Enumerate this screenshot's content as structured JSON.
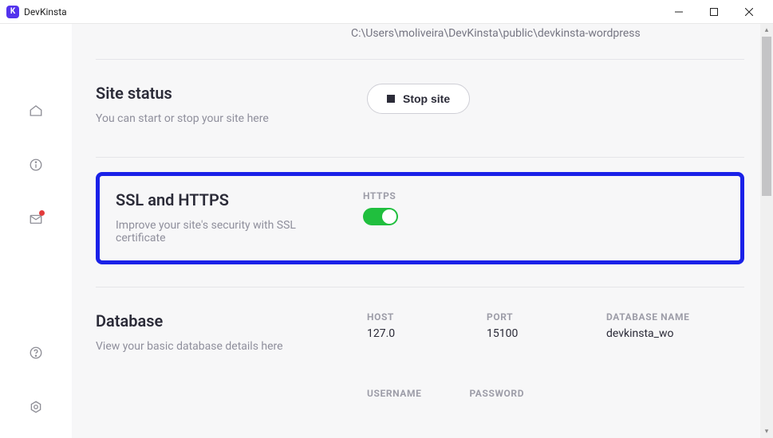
{
  "window": {
    "title": "DevKinsta"
  },
  "path": "C:\\Users\\moliveira\\DevKinsta\\public\\devkinsta-wordpress",
  "sections": {
    "status": {
      "title": "Site status",
      "desc": "You can start or stop your site here",
      "button": "Stop site"
    },
    "ssl": {
      "title": "SSL and HTTPS",
      "desc": "Improve your site's security with SSL certificate",
      "toggle_label": "HTTPS",
      "toggle_on": true
    },
    "database": {
      "title": "Database",
      "desc": "View your basic database details here",
      "host": {
        "label": "HOST",
        "value": "127.0"
      },
      "port": {
        "label": "PORT",
        "value": "15100"
      },
      "name": {
        "label": "DATABASE NAME",
        "value": "devkinsta_wo"
      },
      "user": {
        "label": "USERNAME",
        "value": ""
      },
      "pass": {
        "label": "PASSWORD",
        "value": ""
      }
    }
  }
}
